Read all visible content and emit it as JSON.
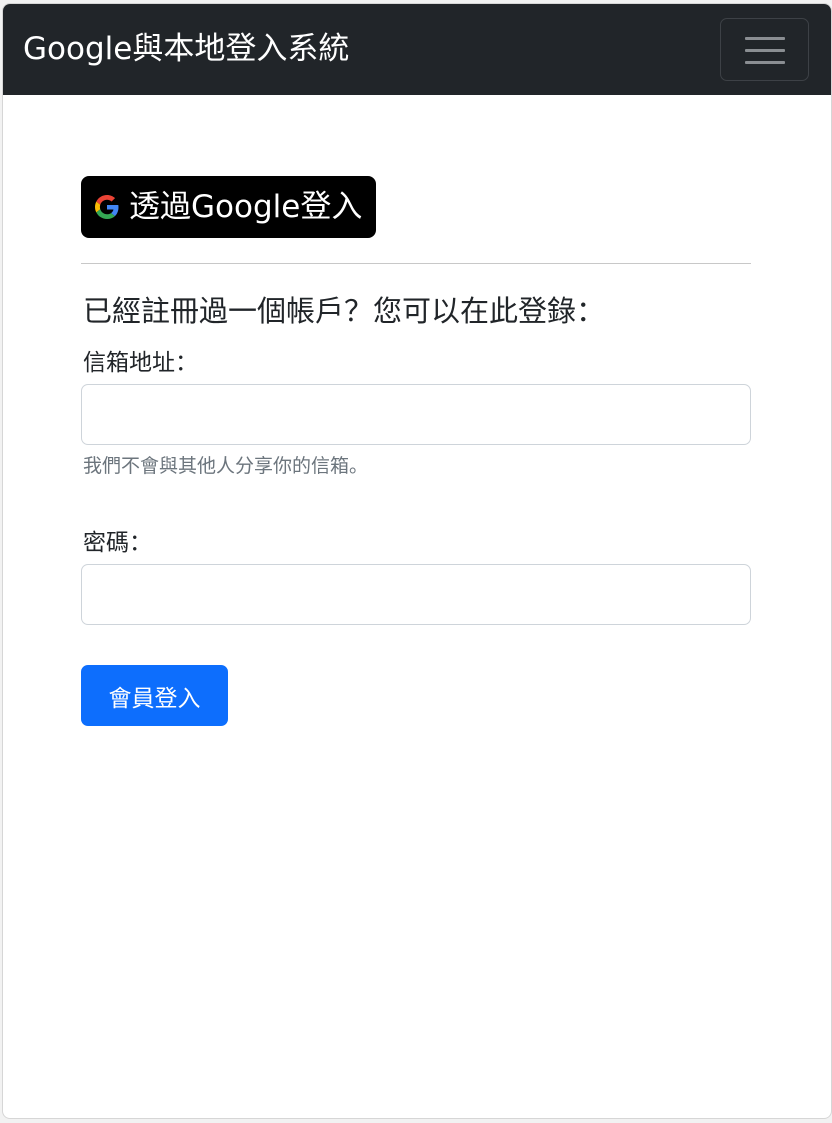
{
  "navbar": {
    "brand": "Google與本地登入系統",
    "toggler_icon": "hamburger-menu-icon"
  },
  "google_login": {
    "icon": "google-g-icon",
    "label": "透過Google登入"
  },
  "login_form": {
    "heading": "已經註冊過一個帳戶？您可以在此登錄：",
    "email": {
      "label": "信箱地址：",
      "value": "",
      "placeholder": "",
      "help": "我們不會與其他人分享你的信箱。"
    },
    "password": {
      "label": "密碼：",
      "value": "",
      "placeholder": ""
    },
    "submit_label": "會員登入"
  },
  "colors": {
    "navbar_bg": "#212529",
    "google_button_bg": "#000000",
    "primary": "#0d6efd",
    "muted_text": "#6c757d"
  }
}
